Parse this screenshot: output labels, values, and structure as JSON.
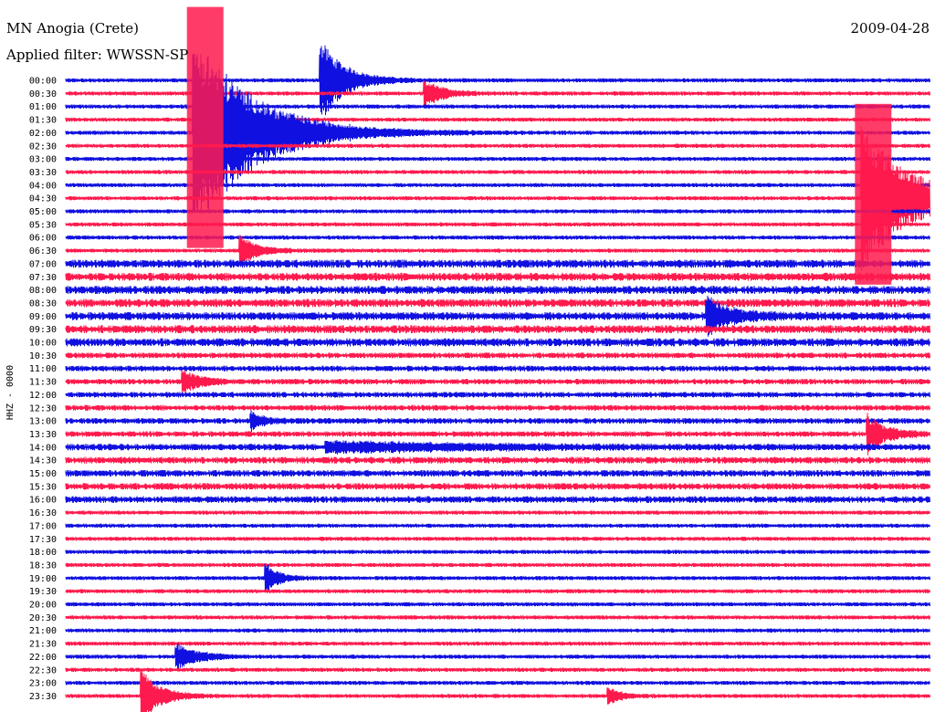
{
  "header": {
    "station": "MN Anogia (Crete)",
    "filter": "Applied filter: WWSSN-SP",
    "date": "2009-04-28"
  },
  "chart_data": {
    "type": "line",
    "title": "MN Anogia (Crete)",
    "subtitle": "Applied filter: WWSSN-SP",
    "ylabel": "HHZ - 0000",
    "date": "2009-04-28",
    "grid": false,
    "rows": [
      "00:00",
      "00:30",
      "01:00",
      "01:30",
      "02:00",
      "02:30",
      "03:00",
      "03:30",
      "04:00",
      "04:30",
      "05:00",
      "05:30",
      "06:00",
      "06:30",
      "07:00",
      "07:30",
      "08:00",
      "08:30",
      "09:00",
      "09:30",
      "10:00",
      "10:30",
      "11:00",
      "11:30",
      "12:00",
      "12:30",
      "13:00",
      "13:30",
      "14:00",
      "14:30",
      "15:00",
      "15:30",
      "16:00",
      "16:30",
      "17:00",
      "17:30",
      "18:00",
      "18:30",
      "19:00",
      "19:30",
      "20:00",
      "20:30",
      "21:00",
      "21:30",
      "22:00",
      "22:30",
      "23:00",
      "23:30"
    ],
    "colors": [
      "#1010e0",
      "#ff1a4d"
    ],
    "events": [
      {
        "row": "02:00",
        "minute": 4.4,
        "peak": 8,
        "decay": 2.0,
        "long_tail": true
      },
      {
        "row": "00:00",
        "minute": 8.8,
        "peak": 3.4,
        "decay": 0.8,
        "long_tail": false
      },
      {
        "row": "00:30",
        "minute": 12.4,
        "peak": 1.2,
        "decay": 0.6,
        "long_tail": false
      },
      {
        "row": "04:30",
        "minute": 27.6,
        "peak": 6,
        "decay": 1.6,
        "long_tail": true
      },
      {
        "row": "06:30",
        "minute": 6.0,
        "peak": 1.3,
        "decay": 0.6,
        "long_tail": false
      },
      {
        "row": "09:00",
        "minute": 22.2,
        "peak": 1.6,
        "decay": 0.8,
        "long_tail": false
      },
      {
        "row": "11:30",
        "minute": 4.0,
        "peak": 1.0,
        "decay": 0.6,
        "long_tail": false
      },
      {
        "row": "13:00",
        "minute": 6.4,
        "peak": 0.8,
        "decay": 0.4,
        "long_tail": false
      },
      {
        "row": "14:00",
        "minute": 9.0,
        "peak": 0.4,
        "decay": 4.5,
        "long_tail": false
      },
      {
        "row": "19:00",
        "minute": 6.9,
        "peak": 1.4,
        "decay": 0.4,
        "long_tail": false
      },
      {
        "row": "22:00",
        "minute": 3.8,
        "peak": 1.1,
        "decay": 0.7,
        "long_tail": false
      },
      {
        "row": "23:30",
        "minute": 2.6,
        "peak": 2.2,
        "decay": 0.6,
        "long_tail": false
      },
      {
        "row": "23:30",
        "minute": 18.8,
        "peak": 0.8,
        "decay": 0.4,
        "long_tail": false
      },
      {
        "row": "13:30",
        "minute": 27.8,
        "peak": 1.6,
        "decay": 0.6,
        "long_tail": false
      }
    ]
  }
}
